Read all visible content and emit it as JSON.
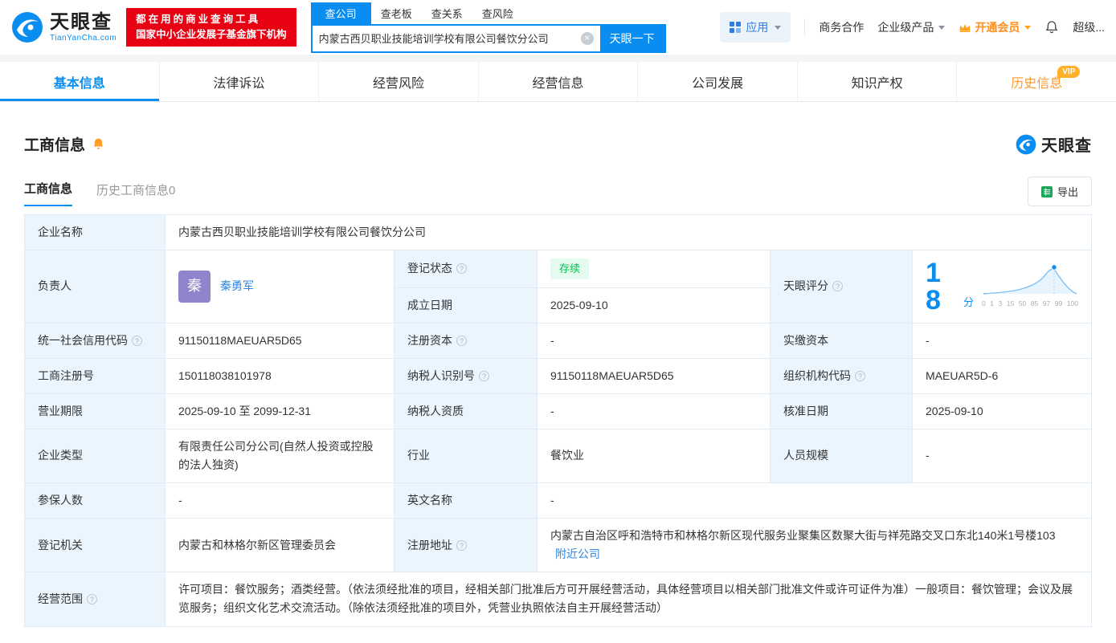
{
  "brand": {
    "name": "天眼查",
    "domain": "TianYanCha.com"
  },
  "header": {
    "slogan_line1": "都在用的商业查询工具",
    "slogan_line2": "国家中小企业发展子基金旗下机构",
    "search_tabs": [
      "查公司",
      "查老板",
      "查关系",
      "查风险"
    ],
    "search_value": "内蒙古西贝职业技能培训学校有限公司餐饮分公司",
    "search_button": "天眼一下",
    "apps_label": "应用",
    "biz_link": "商务合作",
    "enterprise_link": "企业级产品",
    "vip_link": "开通会员",
    "super_link": "超级..."
  },
  "nav_tabs": [
    {
      "label": "基本信息"
    },
    {
      "label": "法律诉讼"
    },
    {
      "label": "经营风险"
    },
    {
      "label": "经营信息"
    },
    {
      "label": "公司发展"
    },
    {
      "label": "知识产权"
    },
    {
      "label": "历史信息",
      "badge": "VIP"
    }
  ],
  "section": {
    "title": "工商信息",
    "brand": "天眼查"
  },
  "sub_tabs": {
    "current": "工商信息",
    "history": "历史工商信息",
    "history_count": "0",
    "export": "导出"
  },
  "score": {
    "label": "天眼评分",
    "value": "18",
    "unit": "分",
    "ticks": [
      "0",
      "1",
      "3",
      "15",
      "50",
      "85",
      "97",
      "99",
      "100"
    ]
  },
  "fields": {
    "company_name_label": "企业名称",
    "company_name": "内蒙古西贝职业技能培训学校有限公司餐饮分公司",
    "legal_rep_label": "负责人",
    "legal_rep_avatar": "秦",
    "legal_rep_name": "秦勇军",
    "reg_status_label": "登记状态",
    "reg_status": "存续",
    "est_date_label": "成立日期",
    "est_date": "2025-09-10",
    "uscc_label": "统一社会信用代码",
    "uscc": "91150118MAEUAR5D65",
    "reg_capital_label": "注册资本",
    "reg_capital": "-",
    "paid_capital_label": "实缴资本",
    "paid_capital": "-",
    "reg_number_label": "工商注册号",
    "reg_number": "150118038101978",
    "taxpayer_id_label": "纳税人识别号",
    "taxpayer_id": "91150118MAEUAR5D65",
    "org_code_label": "组织机构代码",
    "org_code": "MAEUAR5D-6",
    "business_term_label": "营业期限",
    "business_term": "2025-09-10 至 2099-12-31",
    "taxpayer_quality_label": "纳税人资质",
    "taxpayer_quality": "-",
    "approval_date_label": "核准日期",
    "approval_date": "2025-09-10",
    "company_type_label": "企业类型",
    "company_type": "有限责任公司分公司(自然人投资或控股的法人独资)",
    "industry_label": "行业",
    "industry": "餐饮业",
    "staff_size_label": "人员规模",
    "staff_size": "-",
    "insured_label": "参保人数",
    "insured": "-",
    "english_name_label": "英文名称",
    "english_name": "-",
    "reg_authority_label": "登记机关",
    "reg_authority": "内蒙古和林格尔新区管理委员会",
    "reg_address_label": "注册地址",
    "reg_address": "内蒙古自治区呼和浩特市和林格尔新区现代服务业聚集区数聚大街与祥苑路交叉口东北140米1号楼103",
    "nearby_link": "附近公司",
    "business_scope_label": "经营范围",
    "business_scope": "许可项目：餐饮服务；酒类经营。（依法须经批准的项目，经相关部门批准后方可开展经营活动，具体经营项目以相关部门批准文件或许可证件为准）一般项目：餐饮管理；会议及展览服务；组织文化艺术交流活动。（除依法须经批准的项目外，凭营业执照依法自主开展经营活动）"
  }
}
